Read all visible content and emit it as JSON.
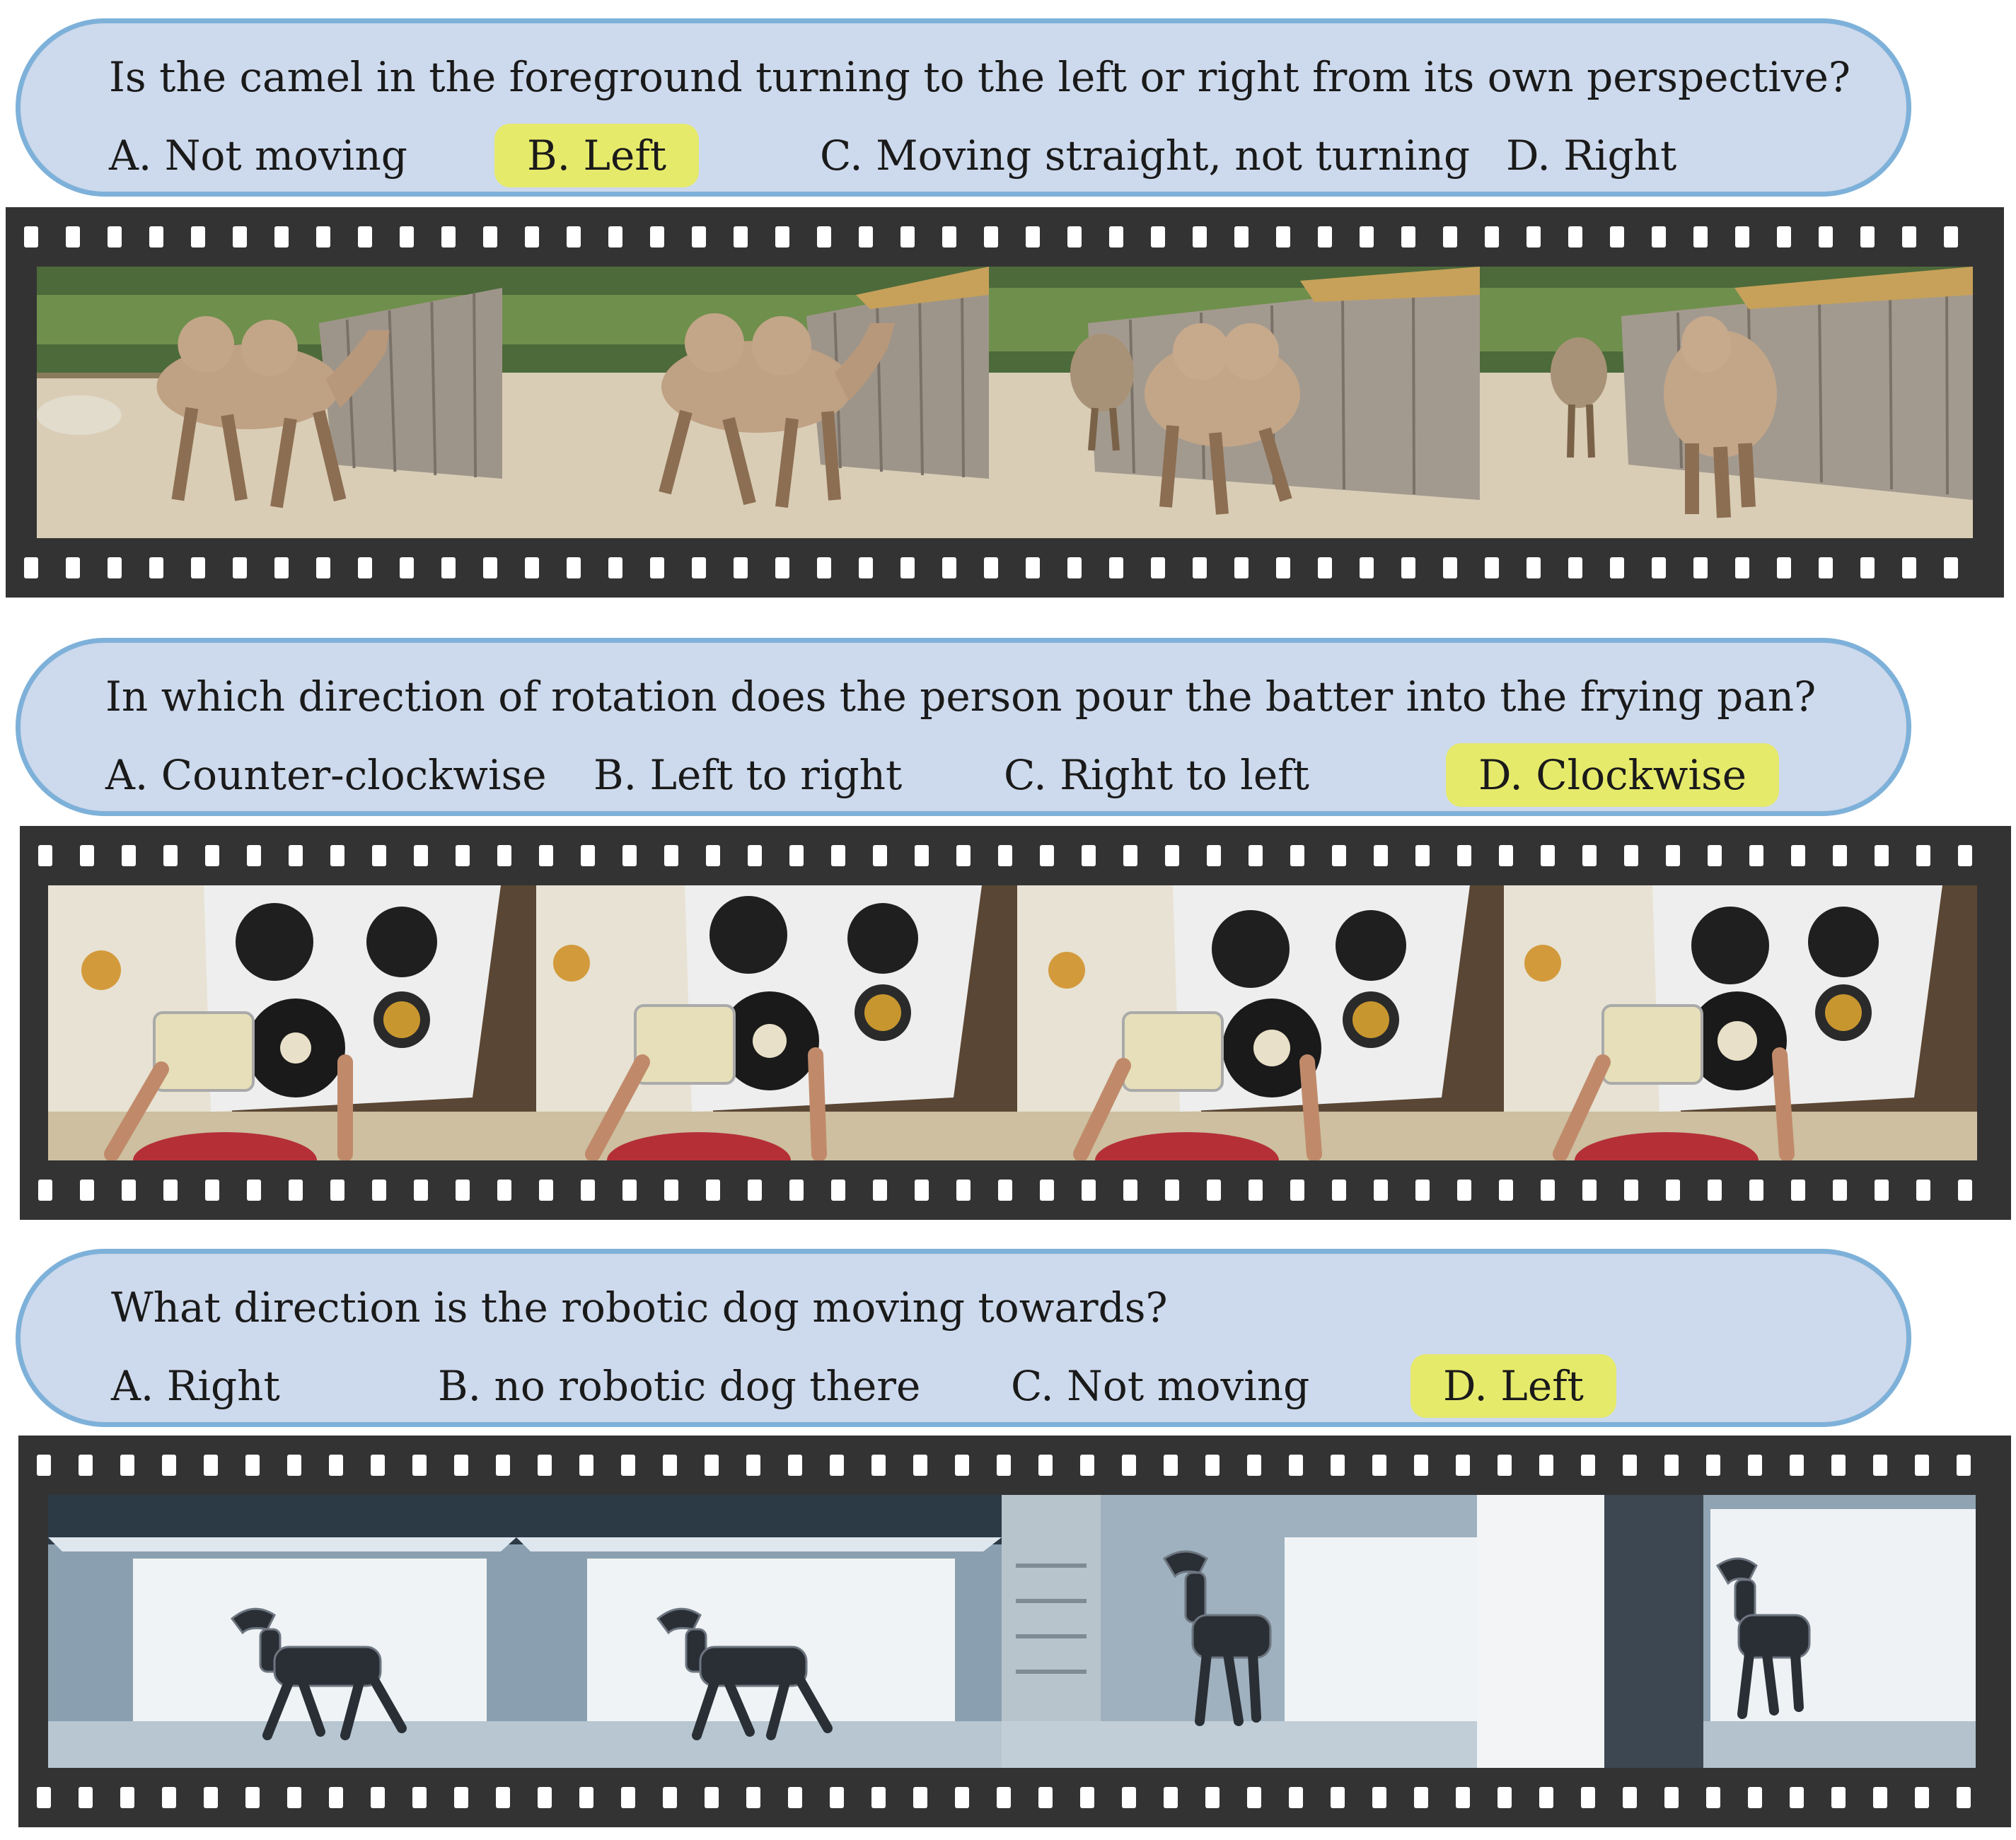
{
  "questions": [
    {
      "question": "Is the camel in the foreground turning to the left or right from its own perspective?",
      "options": [
        "A. Not moving",
        "B. Left",
        "C. Moving straight, not turning",
        "D. Right"
      ],
      "correct_index": 1,
      "frames": [
        "camel-frame-1",
        "camel-frame-2",
        "camel-frame-3",
        "camel-frame-4"
      ]
    },
    {
      "question": "In which direction of rotation does the person pour the batter into the frying pan?",
      "options": [
        "A. Counter-clockwise",
        "B. Left to right",
        "C. Right to left",
        "D. Clockwise"
      ],
      "correct_index": 3,
      "frames": [
        "stove-frame-1",
        "stove-frame-2",
        "stove-frame-3",
        "stove-frame-4"
      ]
    },
    {
      "question": "What direction is the robotic dog moving towards?",
      "options": [
        "A. Right",
        "B. no robotic dog there",
        "C. Not moving",
        "D. Left"
      ],
      "correct_index": 3,
      "frames": [
        "robot-dog-frame-1",
        "robot-dog-frame-2",
        "robot-dog-frame-3",
        "robot-dog-frame-4"
      ]
    }
  ],
  "colors": {
    "bubble_fill": "#cdd9ec",
    "bubble_border": "#7eb1d9",
    "answer_highlight": "#e6ea6b",
    "film_strip": "#333333"
  }
}
